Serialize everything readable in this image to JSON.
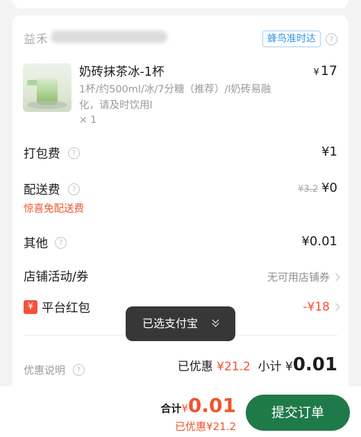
{
  "store": {
    "name": "益禾",
    "delivery_badge": "蜂鸟准时达"
  },
  "product": {
    "name": "奶砖抹茶冰-1杯",
    "spec": "1杯/约500ml/冰/7分糖（推荐）/l奶砖易融化，请及时饮用l",
    "quantity": "× 1",
    "price_symbol": "¥",
    "price": "17"
  },
  "fees": {
    "packaging_label": "打包费",
    "packaging_value": "¥1",
    "delivery_label": "配送费",
    "delivery_original": "¥3.2",
    "delivery_value": "¥0",
    "delivery_note": "惊喜免配送费",
    "other_label": "其他",
    "other_value": "¥0.01",
    "store_coupon_label": "店铺活动/券",
    "store_coupon_value": "无可用店铺券",
    "redpack_icon": "¥",
    "redpack_label": "平台红包",
    "redpack_value": "-¥18"
  },
  "summary": {
    "promo_label": "优惠说明",
    "discount_label": "已优惠",
    "discount_value": "¥21.2",
    "subtotal_label": "小计",
    "subtotal_symbol": "¥",
    "subtotal_value": "0.01"
  },
  "toast": {
    "text": "已选支付宝"
  },
  "bottom": {
    "total_label": "合计",
    "total_symbol": "¥",
    "total_value": "0.01",
    "saved_text": "已优惠¥21.2",
    "submit_label": "提交订单"
  },
  "colors": {
    "accent_red": "#f0542c",
    "submit_green": "#1f7a4a",
    "badge_blue": "#2f94e8"
  },
  "icons": [
    "help-icon",
    "chevron-right-icon",
    "double-chevron-down-icon",
    "red-packet-icon"
  ]
}
